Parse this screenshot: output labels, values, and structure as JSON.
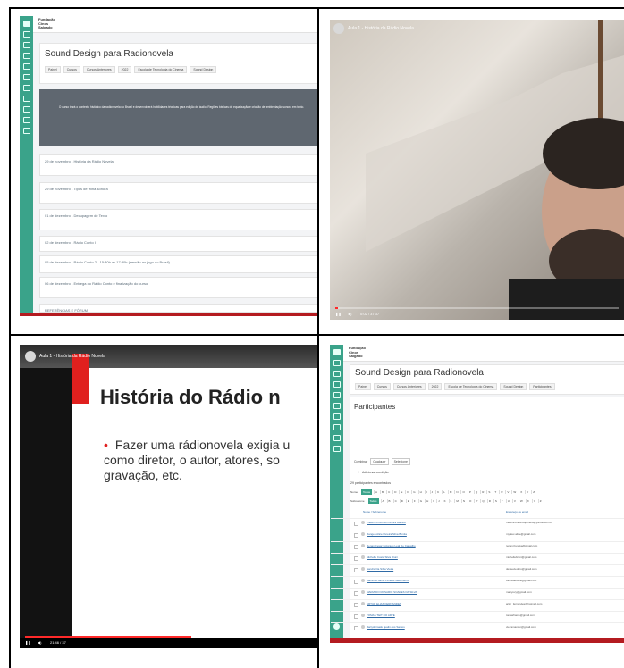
{
  "moodle": {
    "logo": "Fundação\nCinos\nSalgado",
    "course_title": "Sound Design para Radionovela",
    "breadcrumbs": [
      "Painel",
      "Cursos",
      "Cursos Anteriores",
      "2022",
      "Escola de Tecnologia do Cinema",
      "Sound Design"
    ],
    "breadcrumbs_participants": [
      "Painel",
      "Cursos",
      "Cursos Anteriores",
      "2022",
      "Escola de Tecnologia do Cinema",
      "Sound Design",
      "Participantes"
    ],
    "banner_text": "O curso trará o contexto histórico da radionovela no Brasil e desenvolverá habilidades técnicas para edição de áudio. Regiões básicas de equalização e criação de ambientação sonora em texto.",
    "sections": [
      "29 de novembro - História da Rádio Novela",
      "29 de novembro - Tipos de trilha sonora",
      "01 de dezembro - Decupagem de Texto",
      "02 de dezembro - Rádio Conto I",
      "05 de dezembro - Rádio Conto 2 - 15:30h as 17:30h (sessão ao jogo do Brasil)",
      "06 de dezembro - Entrega do Rádio Conto e finalização do curso",
      "REFERÊNCIAS E FÓRUM"
    ]
  },
  "video": {
    "title": "Aula 1 - História da Rádio Novela",
    "time_top": "0:02 / 37:37",
    "time_bottom": "21:46 / 37",
    "progress_top": 0.01,
    "progress_bottom": 0.58
  },
  "slide": {
    "title": "História do Rádio n",
    "body": "Fazer uma rádionovela exigia u como diretor, o autor, atores, so gravação, etc."
  },
  "participants": {
    "heading": "Participantes",
    "filter_label": "Combinar",
    "filter_any": "Qualquer",
    "filter_select": "Selecione",
    "add_condition": "Adicionar condição",
    "count": "29 participantes encontrados",
    "first_name_label": "Nome",
    "surname_label": "Sobrenome",
    "all": "Todos",
    "letters": [
      "A",
      "B",
      "C",
      "D",
      "E",
      "F",
      "G",
      "H",
      "I",
      "J",
      "K",
      "L",
      "M",
      "N",
      "O",
      "P",
      "Q",
      "R",
      "S",
      "T",
      "U",
      "V",
      "W",
      "X",
      "Y",
      "Z"
    ],
    "col_name": "Nome / Sobrenome",
    "col_email": "Endereço de email",
    "rows": [
      {
        "name": "Frederico Afonso Pereira Barreto",
        "email": "frederico.afonsopereira@yahoo.com.br"
      },
      {
        "name": "Rangea Alice Pereira Silva Bonita",
        "email": "myalex.aline@gmail.com"
      },
      {
        "name": "Renan Cesar Colorado Leal De Carvalho",
        "email": "renan.frenoka@gmail.com"
      },
      {
        "name": "Michelle Costa Silva Bruni",
        "email": "michellebruni@gmail.com"
      },
      {
        "name": "Sandra Da Silva Vieira",
        "email": "devseviedaru@gmail.com"
      },
      {
        "name": "Maria da Santa Pereira Nascimento",
        "email": "carmillabifele@gmail.com"
      },
      {
        "name": "MARIA DO ROSARIO SOARES DA SILVA",
        "email": "mariyovy@gmail.com"
      },
      {
        "name": "ARTUR ELIAS FERNANDES",
        "email": "artur_fernandes@hotmail.com"
      },
      {
        "name": "TOMAS TEIT DO ARTE",
        "email": "tomasframe@gmail.com"
      },
      {
        "name": "Bartyshimask qualin dos Santos",
        "email": "vieiramanian@gmail.com"
      }
    ]
  }
}
